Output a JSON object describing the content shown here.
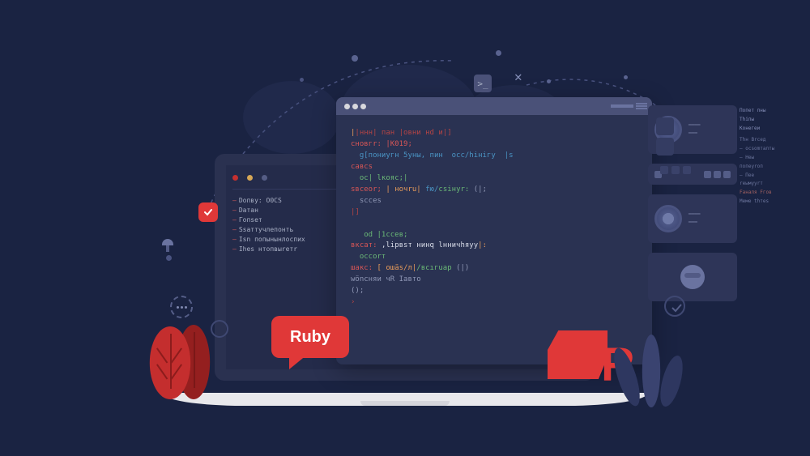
{
  "bubble_label": "Ruby",
  "r_letter": "R",
  "sidebar": {
    "items": [
      "Dопвy: О0СS",
      "Dатан",
      "Гопsет",
      "Ssaттучлепонть",
      "Isn попынынлоспих",
      "Ihes нтопвыreтr"
    ]
  },
  "refpanel": {
    "title": "Попет пны Тhiпы Kонегеи",
    "lines": [
      "Thн Brcед",
      "— ocsоmталты",
      "— Неы попеyrоп",
      "— Пeе reымуyrт",
      "",
      "Fаналя Fгoв",
      "",
      "Меме thтes"
    ]
  },
  "code": {
    "block1": [
      "|ннн| пан |овни нd и|]",
      "сновгr: |К019;",
      "  g[пониyгн 5уны, пин  осс/hiнiгу  |s",
      "савсs",
      "  ос| lкояс;|",
      "sвсеоr; | ночru| fю/csiнуr: (|;",
      "  sссеs",
      "|]"
    ],
    "block2": [
      "   оd |1ссев;",
      "вксат: ,lipвsт нинq lнничhяуу|:",
      "  оссоrт",
      "шакс: [ ошäs/л|/всıгuар (|)",
      "wönсняи чR Iавто",
      "();",
      "›"
    ]
  },
  "icons": {
    "terminal": ">_",
    "close": "✕",
    "check": "✓"
  }
}
